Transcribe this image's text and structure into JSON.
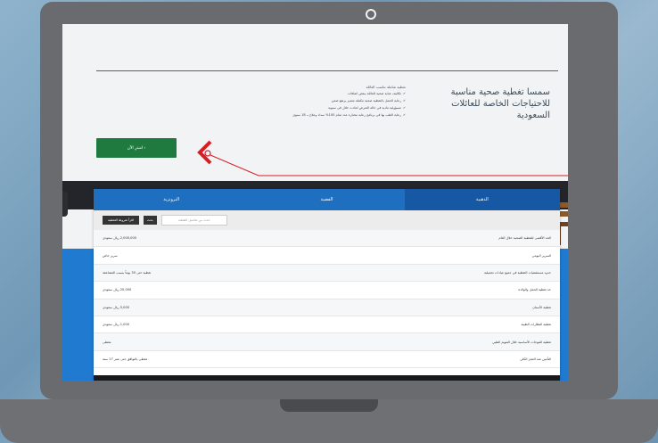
{
  "hero": {
    "title": "سمسا تغطية صحية مناسبة للاحتياجات الخاصة للعائلات السعودية",
    "features_heading": "تغطية شاملة تناسب العائلة",
    "features": [
      "تكاليف عناية صحية للعائلة ببعض اضافات",
      "رعاية الحمل بالتغطية صحية مكملة متميز يرتفع ضمن",
      "مسؤولية مادية في حالة التعرض لحادث خلال في سنوية",
      "رعاية الطب بها في برنامج رعاية مختارة عدد تمام 100% سداد وعلاج بـ 18 سنوي"
    ],
    "cta_label": "اشترِ الآن  ›"
  },
  "tabs": [
    {
      "label": "الذهبية",
      "active": true
    },
    {
      "label": "الفضية",
      "active": false
    },
    {
      "label": "البرونزية",
      "active": false
    }
  ],
  "toolbar": {
    "button_label": "اقرأ شروط التغطية",
    "small_label": "بحث",
    "search_placeholder": "ابحث من تفاصيل التغطية"
  },
  "rows": [
    {
      "label": "الحد الأقصى للتغطية الصحية خلال العام",
      "value": "2,000,000 ريال سعودي"
    },
    {
      "label": "السرير اليومي",
      "value": "سرير خاص"
    },
    {
      "label": "حدود مستشفيات التغطية في جميع عيادات تجميلية",
      "value": "تغطية حتى 30 يوماً بسبب المضاعفة"
    },
    {
      "label": "حد تغطية الحمل والولادة",
      "value": "20,000 ريال سعودي"
    },
    {
      "label": "تغطية الأسنان",
      "value": "5,000 ريال سعودي"
    },
    {
      "label": "تغطية النظارات الطبية",
      "value": "1,000 ريال سعودي"
    },
    {
      "label": "تغطية الموجات الأساسية خلال التنويم الطبي",
      "value": "مغطى"
    },
    {
      "label": "التأمين ضد العجز الكلي",
      "value": "مغطى بالتوافق حتى عمر 17 سنة"
    }
  ]
}
